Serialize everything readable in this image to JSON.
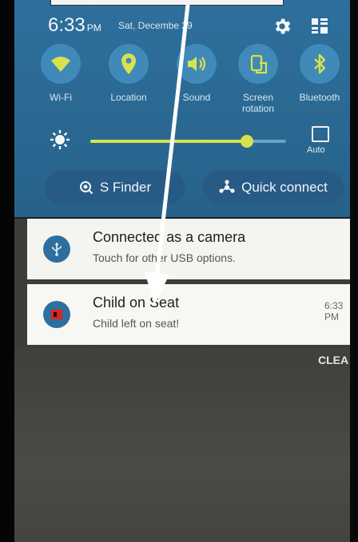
{
  "status_bar": {
    "time": "6:33",
    "ampm": "PM",
    "date": "Sat, Decembe 29"
  },
  "toggles": [
    {
      "label": "Wi-Fi",
      "icon": "wifi-icon"
    },
    {
      "label": "Location",
      "icon": "location-icon"
    },
    {
      "label": "Sound",
      "icon": "sound-icon"
    },
    {
      "label": "Screen rotation",
      "icon": "screen-rotation-icon"
    },
    {
      "label": "Bluetooth",
      "icon": "bluetooth-icon"
    }
  ],
  "brightness": {
    "level": 0.8,
    "auto_label": "Auto"
  },
  "buttons": {
    "s_finder": "S Finder",
    "quick_connect": "Quick connect"
  },
  "notifications": [
    {
      "title": "Connected as a camera",
      "text": "Touch for other USB options.",
      "time": "",
      "icon": "usb-icon"
    },
    {
      "title": "Child on Seat",
      "text": "Child left on seat!",
      "time": "6:33 PM",
      "icon": "alert-icon"
    }
  ],
  "clear_label": "CLEA",
  "colors": {
    "panel": "#2a6891",
    "toggle_circle": "#3f8ab8",
    "slider": "#d9e24c",
    "notification_bg": "#f4f4f1"
  }
}
